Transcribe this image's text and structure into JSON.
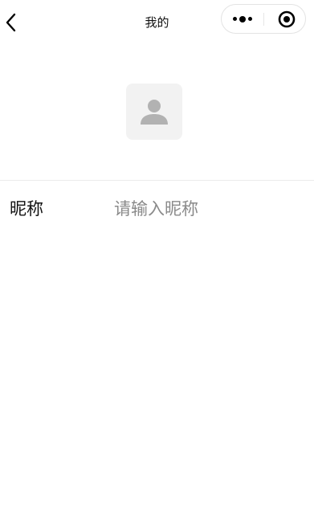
{
  "navbar": {
    "title": "我的",
    "back_icon": "chevron-left-icon",
    "more_icon": "more-dots-icon",
    "close_icon": "record-target-icon"
  },
  "profile": {
    "avatar_icon": "user-placeholder-icon"
  },
  "form": {
    "nickname_label": "昵称",
    "nickname_placeholder": "请输入昵称",
    "nickname_value": ""
  },
  "colors": {
    "background": "#ffffff",
    "avatar_bg": "#f2f2f2",
    "avatar_icon": "#b2b2b2",
    "placeholder": "#8a8a8a",
    "divider": "#ececec"
  }
}
